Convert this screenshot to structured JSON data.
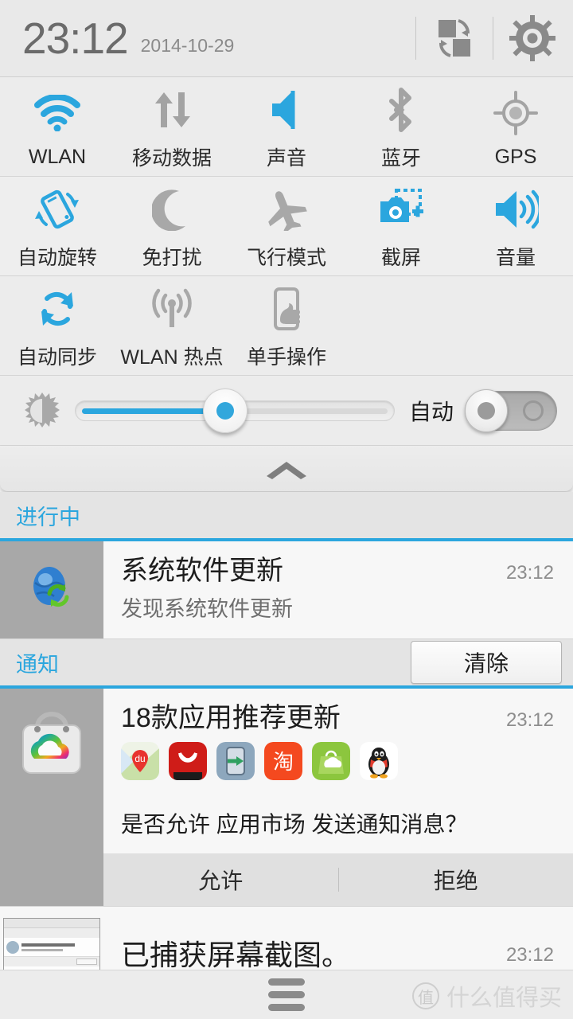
{
  "header": {
    "time": "23:12",
    "date": "2014-10-29",
    "switch_user_icon": "switch-user-icon",
    "settings_icon": "gear-icon"
  },
  "accent_color": "#2ba6de",
  "inactive_color": "#9e9e9e",
  "quick_settings": {
    "rows": [
      [
        {
          "label": "WLAN",
          "icon": "wifi-icon",
          "active": true
        },
        {
          "label": "移动数据",
          "icon": "mobile-data-icon",
          "active": false
        },
        {
          "label": "声音",
          "icon": "sound-icon",
          "active": true
        },
        {
          "label": "蓝牙",
          "icon": "bluetooth-icon",
          "active": false
        },
        {
          "label": "GPS",
          "icon": "gps-icon",
          "active": false
        }
      ],
      [
        {
          "label": "自动旋转",
          "icon": "auto-rotate-icon",
          "active": true
        },
        {
          "label": "免打扰",
          "icon": "do-not-disturb-moon-icon",
          "active": false
        },
        {
          "label": "飞行模式",
          "icon": "airplane-icon",
          "active": false
        },
        {
          "label": "截屏",
          "icon": "screenshot-camera-icon",
          "active": true
        },
        {
          "label": "音量",
          "icon": "volume-icon",
          "active": true
        }
      ],
      [
        {
          "label": "自动同步",
          "icon": "sync-icon",
          "active": true
        },
        {
          "label": "WLAN 热点",
          "icon": "hotspot-icon",
          "active": false
        },
        {
          "label": "单手操作",
          "icon": "one-hand-mode-icon",
          "active": false
        }
      ]
    ]
  },
  "brightness": {
    "icon": "brightness-sun-icon",
    "value_percent": 47,
    "auto_label": "自动",
    "auto_enabled": false
  },
  "collapse": {
    "icon": "chevron-up-icon"
  },
  "sections": {
    "ongoing": {
      "title": "进行中"
    },
    "notifications": {
      "title": "通知",
      "clear_label": "清除"
    }
  },
  "ongoing_notifications": [
    {
      "icon": "system-update-globe-icon",
      "title": "系统软件更新",
      "subtitle": "发现系统软件更新",
      "time": "23:12"
    }
  ],
  "notifications": [
    {
      "icon": "app-market-bag-icon",
      "title": "18款应用推荐更新",
      "time": "23:12",
      "app_icons": [
        {
          "name": "baidu-maps-icon",
          "label": "du"
        },
        {
          "name": "red-shopping-bag-icon",
          "label": ""
        },
        {
          "name": "phone-transfer-icon",
          "label": ""
        },
        {
          "name": "taobao-icon",
          "label": "淘"
        },
        {
          "name": "green-bag-cloud-icon",
          "label": ""
        },
        {
          "name": "qq-penguin-icon",
          "label": ""
        }
      ],
      "prompt": "是否允许 应用市场 发送通知消息？",
      "actions": [
        {
          "label": "允许",
          "name": "allow-button"
        },
        {
          "label": "拒绝",
          "name": "deny-button"
        }
      ]
    },
    {
      "icon": "screenshot-thumbnail",
      "title": "已捕获屏幕截图。",
      "time": "23:12"
    }
  ],
  "bottom_bar": {
    "menu_icon": "menu-icon",
    "watermark_mark": "值",
    "watermark_text": "什么值得买"
  }
}
